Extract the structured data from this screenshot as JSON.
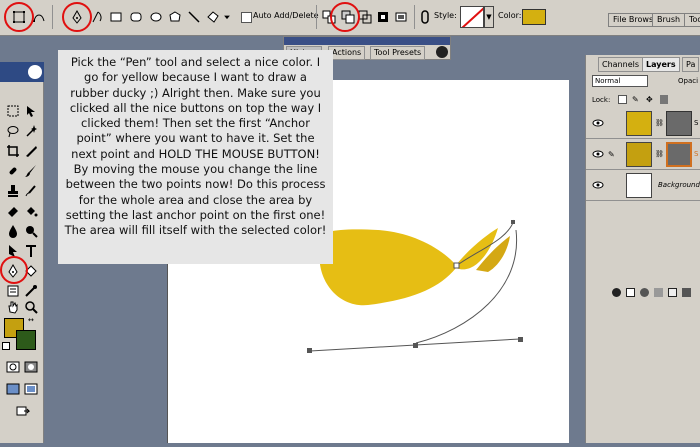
{
  "options_bar": {
    "auto_add_delete_label": "Auto Add/Delete",
    "style_label": "Style:",
    "color_label": "Color:",
    "color_value": "#d4b010",
    "dock_tabs": [
      "File Brows",
      "Brush",
      "Tool"
    ]
  },
  "history_palette": {
    "tabs": [
      "History",
      "Actions",
      "Tool Presets"
    ]
  },
  "callout": {
    "text": "Pick the “Pen” tool and select a nice color. I go for yellow because I want to draw a rubber ducky ;) Alright then. Make sure you clicked all the nice buttons on top the way I clicked them! Then set the first “Anchor point” where you want to have it. Set the next point and HOLD THE MOUSE BUTTON! By moving the mouse you change the line between the two points now! Do this process for the whole area and close the area by setting the last anchor point on the first one! The area will fill itself with the selected color!"
  },
  "toolbox": {
    "foreground_color": "#c4a010",
    "background_color": "#2d5a1a"
  },
  "layers_panel": {
    "tabs": [
      "Channels",
      "Layers",
      "Pa"
    ],
    "blend_mode": "Normal",
    "opacity_label": "Opaci",
    "lock_label": "Lock:",
    "layers": [
      {
        "name": "S",
        "thumb_color": "#d4b010",
        "has_mask": true
      },
      {
        "name": "S",
        "thumb_color": "#c4a010",
        "has_mask": true
      },
      {
        "name": "Background",
        "thumb_color": "#ffffff",
        "has_mask": false
      }
    ]
  },
  "highlight_color": "#e01010",
  "shape_fill": "#e6be14"
}
